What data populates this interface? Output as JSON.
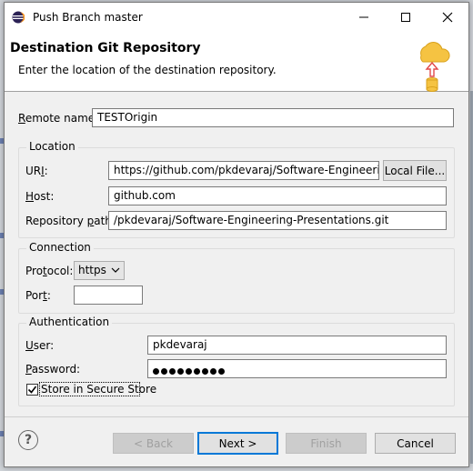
{
  "window": {
    "title": "Push Branch master"
  },
  "banner": {
    "title": "Destination Git Repository",
    "description": "Enter the location of the destination repository."
  },
  "remote": {
    "label_first": "R",
    "label_rest": "emote name:",
    "value": "TESTOrigin"
  },
  "location": {
    "group_title": "Location",
    "uri_label_pre": "UR",
    "uri_label_ul": "I",
    "uri_label_post": ":",
    "uri_value": "https://github.com/pkdevaraj/Software-Engineering-Presentations.git",
    "local_file_button": "Local File...",
    "host_label_ul": "H",
    "host_label_rest": "ost:",
    "host_value": "github.com",
    "repo_path_label_pre": "Repository ",
    "repo_path_label_ul": "p",
    "repo_path_label_post": "ath:",
    "repo_path_value": "/pkdevaraj/Software-Engineering-Presentations.git"
  },
  "connection": {
    "group_title": "Connection",
    "protocol_label_pre": "Pro",
    "protocol_label_ul": "t",
    "protocol_label_post": "ocol:",
    "protocol_value": "https",
    "port_label_pre": "Por",
    "port_label_ul": "t",
    "port_label_post": ":",
    "port_value": ""
  },
  "authentication": {
    "group_title": "Authentication",
    "user_label_ul": "U",
    "user_label_rest": "ser:",
    "user_value": "pkdevaraj",
    "password_label_ul": "P",
    "password_label_rest": "assword:",
    "password_length": 9,
    "store_label": "Store in Secure Store",
    "store_checked": true
  },
  "buttons": {
    "back": "< Back",
    "back_ul": "B",
    "next": "Next >",
    "finish": "Finish",
    "cancel": "Cancel"
  },
  "icons": {
    "app": "eclipse-icon",
    "help": "help-icon",
    "banner": "cloud-push-icon",
    "minimize": "minimize-icon",
    "maximize": "maximize-icon",
    "close": "close-icon",
    "dropdown": "chevron-down-icon",
    "checkbox": "checkmark-icon"
  },
  "colors": {
    "accent": "#0078d7",
    "cloud": "#f5c342",
    "arrow": "#e24a4a"
  }
}
